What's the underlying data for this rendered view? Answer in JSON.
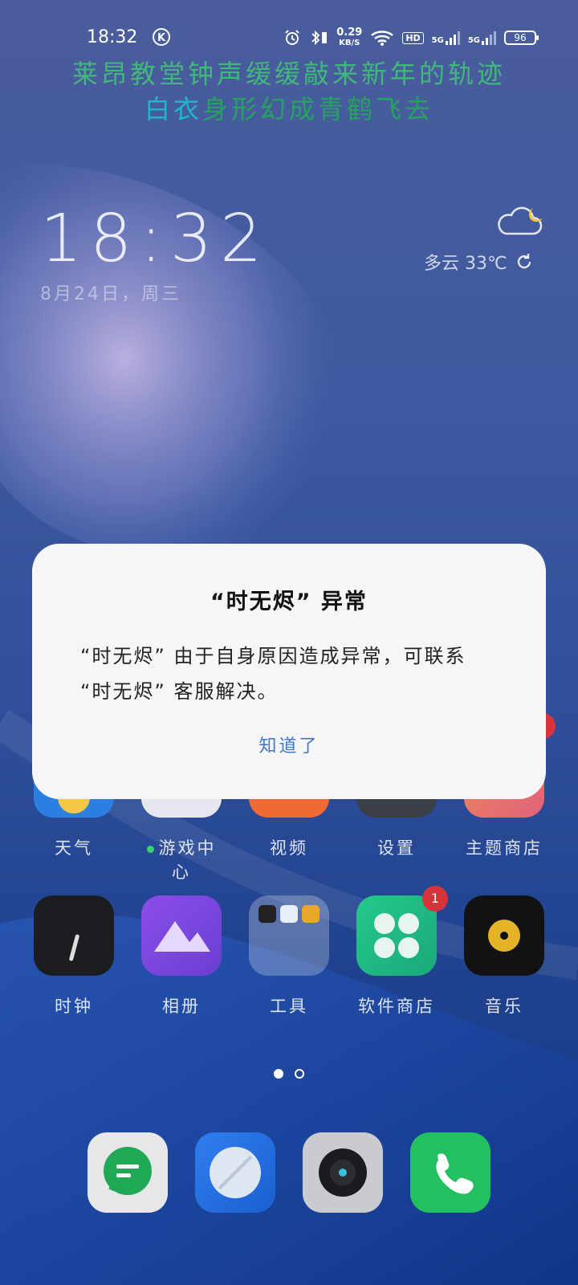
{
  "status_bar": {
    "time": "18:32",
    "k_badge": "K",
    "net_speed": "0.29",
    "net_unit": "KB/S",
    "hd": "HD",
    "sim1": "5G",
    "sim2": "5G",
    "battery": "96"
  },
  "lyrics": {
    "line1": "莱昂教堂钟声缓缓敲来新年的轨迹",
    "line2_highlight": "白衣",
    "line2_rest": "身形幻成青鹤飞去"
  },
  "widget": {
    "clock": "18:32",
    "date": "8月24日，周三",
    "weather": "多云 33℃"
  },
  "apps_row1": [
    {
      "label": "天气"
    },
    {
      "label": "游戏中心"
    },
    {
      "label": "视频"
    },
    {
      "label": "设置"
    },
    {
      "label": "主题商店"
    }
  ],
  "apps_row2": [
    {
      "label": "时钟"
    },
    {
      "label": "相册"
    },
    {
      "label": "工具"
    },
    {
      "label": "软件商店",
      "badge": "1"
    },
    {
      "label": "音乐"
    }
  ],
  "dialog": {
    "title": "“时无烬” 异常",
    "message": "“时无烬” 由于自身原因造成异常，可联系 “时无烬” 客服解决。",
    "button": "知道了"
  },
  "colors": {
    "accent_button": "#3d79c6",
    "badge_red": "#d8323b",
    "lyric_green": "#3fb87a",
    "lyric_cyan": "#1fb7c9"
  }
}
